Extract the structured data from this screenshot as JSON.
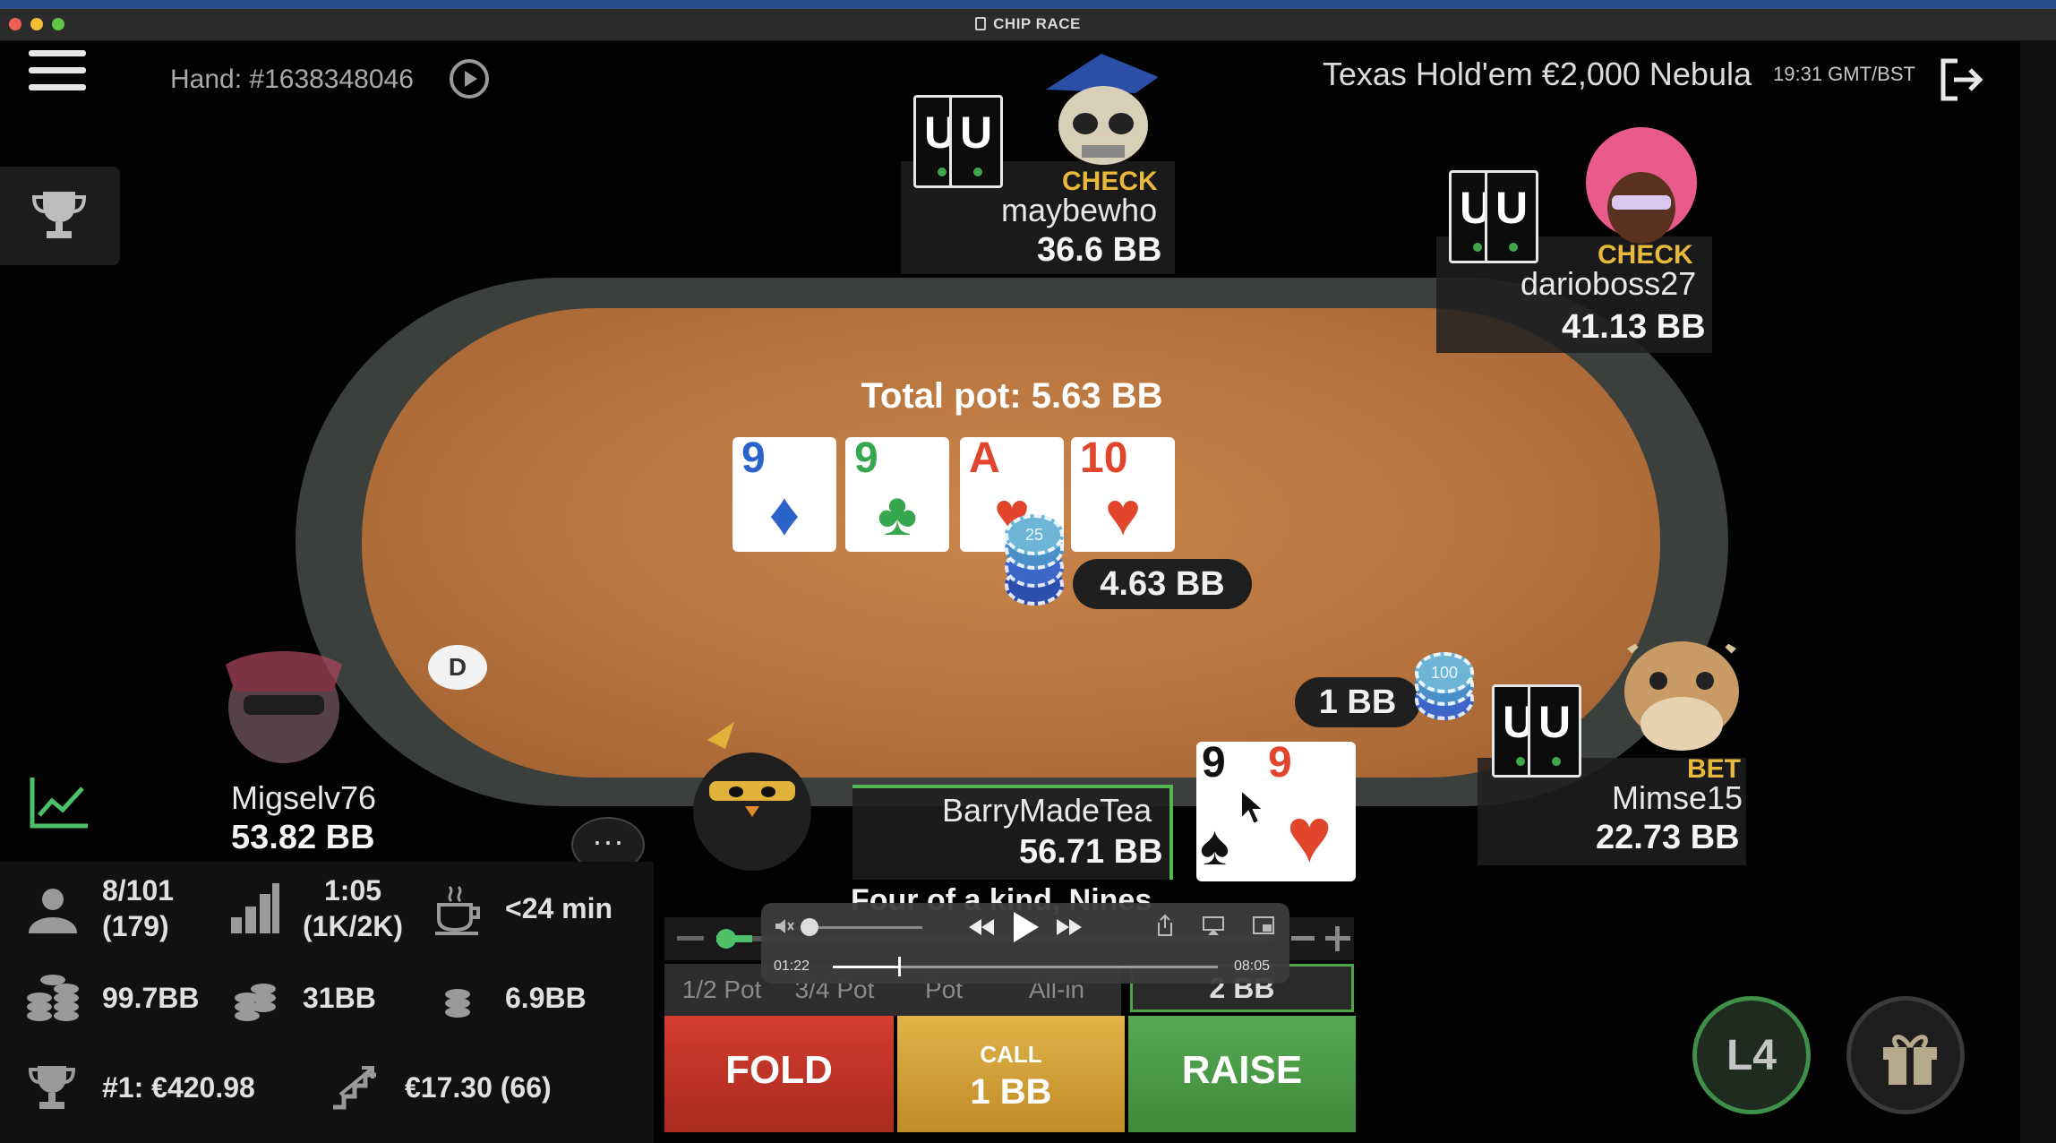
{
  "window": {
    "title": "CHIP RACE"
  },
  "header": {
    "hand_number": "Hand: #1638348046",
    "table_info": "Texas Hold'em  €2,000 Nebula",
    "clock": "19:31 GMT/BST"
  },
  "pot": {
    "total": "Total pot: 5.63 BB",
    "bet_pill": "4.63 BB",
    "chip_value": "25"
  },
  "board": [
    {
      "rank": "9",
      "suit": "♦",
      "color": "blue"
    },
    {
      "rank": "9",
      "suit": "♣",
      "color": "green"
    },
    {
      "rank": "A",
      "suit": "♥",
      "color": "red"
    },
    {
      "rank": "10",
      "suit": "♥",
      "color": "red"
    }
  ],
  "players": {
    "top": {
      "name": "maybewho",
      "stack": "36.6 BB",
      "action": "CHECK"
    },
    "top_right": {
      "name": "darioboss27",
      "stack": "41.13 BB",
      "action": "CHECK"
    },
    "right": {
      "name": "Mimse15",
      "stack": "22.73 BB",
      "action": "BET",
      "bet": "1 BB",
      "chip_value": "100"
    },
    "left": {
      "name": "Migselv76",
      "stack": "53.82 BB"
    },
    "hero": {
      "name": "BarryMadeTea",
      "stack": "56.71 BB",
      "hand_rank": "Four of a kind, Nines",
      "cards": [
        {
          "rank": "9",
          "suit": "♠",
          "color": "black"
        },
        {
          "rank": "9",
          "suit": "♥",
          "color": "red"
        }
      ]
    }
  },
  "dealer_button": "D",
  "hidden_card_letter": "U",
  "stats": {
    "players": "8/101",
    "players_total": "(179)",
    "blinds_time": "1:05",
    "blinds_level": "(1K/2K)",
    "break": "<24 min",
    "avg_stack": "99.7BB",
    "stack2": "31BB",
    "stack3": "6.9BB",
    "prize": "#1: €420.98",
    "next_payout": "€17.30 (66)"
  },
  "bet_presets": [
    "1/2 Pot",
    "3/4 Pot",
    "Pot",
    "All-in"
  ],
  "raise_amount": "2 BB",
  "actions": {
    "fold": "FOLD",
    "call_label": "CALL",
    "call_amount": "1 BB",
    "raise": "RAISE"
  },
  "player_overlay": {
    "elapsed": "01:22",
    "total": "08:05",
    "progress": 0.17
  },
  "level_badge": "L4",
  "colors": {
    "felt": "#b4713c",
    "fold": "#c8392b",
    "call": "#d8a63a",
    "raise": "#4c9b47",
    "action_text": "#e8b93a"
  }
}
